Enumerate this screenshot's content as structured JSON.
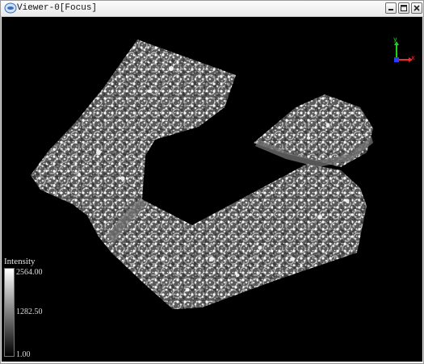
{
  "window": {
    "title": "Viewer-0[Focus]",
    "app_icon": "app-logo-icon",
    "controls": {
      "minimize_icon": "minimize-icon",
      "maximize_icon": "maximize-icon",
      "close_icon": "close-icon"
    }
  },
  "viewport": {
    "background": "#000000",
    "point_color": "#e8e8e8",
    "axes": {
      "y_label": "y",
      "x_label": "x",
      "y_color": "#1fd11f",
      "x_color": "#e53030",
      "z_color": "#2b3cff"
    }
  },
  "scalar_bar": {
    "title": "Intensity",
    "max": "2564.00",
    "mid": "1282.50",
    "min": "1.00"
  }
}
